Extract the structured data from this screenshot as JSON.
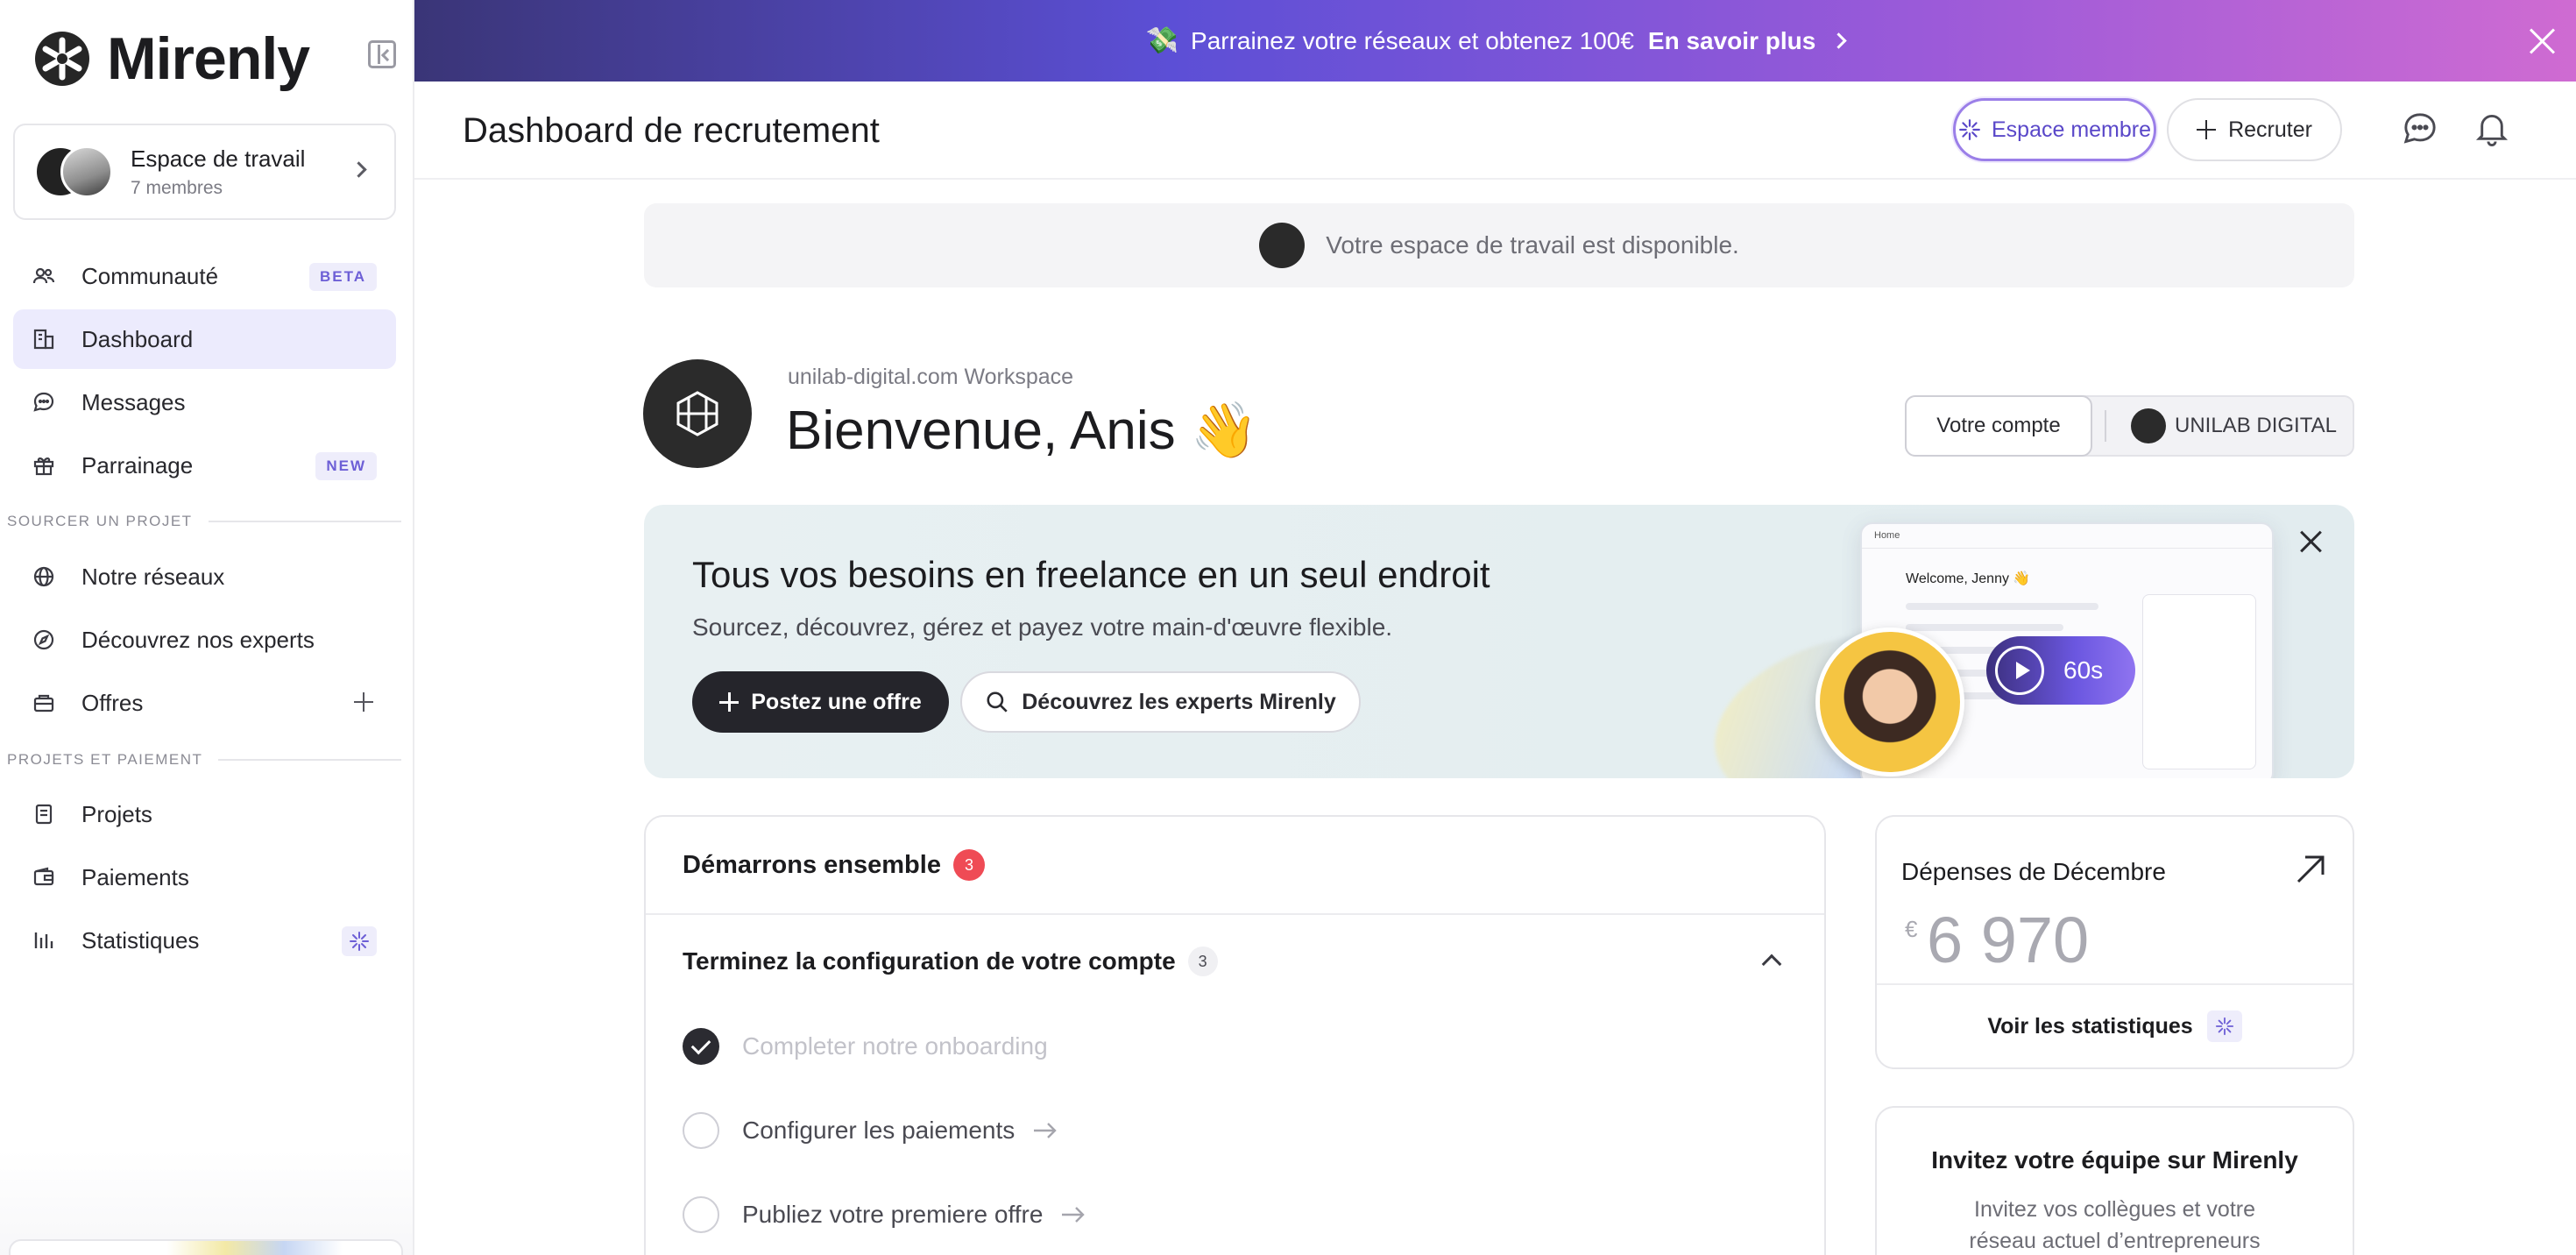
{
  "brand": {
    "name": "Mirenly"
  },
  "sidebar": {
    "workspace": {
      "title": "Espace de travail",
      "members": "7 membres"
    },
    "items": [
      {
        "label": "Communauté",
        "badge": "BETA",
        "icon": "users-icon"
      },
      {
        "label": "Dashboard",
        "icon": "building-icon",
        "active": true
      },
      {
        "label": "Messages",
        "icon": "chat-icon"
      },
      {
        "label": "Parrainage",
        "badge": "NEW",
        "icon": "gift-icon"
      },
      {
        "label": "Notre réseaux",
        "icon": "globe-icon"
      },
      {
        "label": "Découvrez nos experts",
        "icon": "compass-icon"
      },
      {
        "label": "Offres",
        "icon": "box-icon"
      },
      {
        "label": "Projets",
        "icon": "document-icon"
      },
      {
        "label": "Paiements",
        "icon": "wallet-icon"
      },
      {
        "label": "Statistiques",
        "icon": "chart-icon"
      }
    ],
    "sections": {
      "source": "SOURCER UN PROJET",
      "projects": "PROJETS ET PAIEMENT"
    }
  },
  "banner": {
    "emoji": "💸",
    "text": "Parrainez votre réseaux et obtenez 100€",
    "link": "En savoir plus"
  },
  "header": {
    "title": "Dashboard de recrutement",
    "member_button": "Espace membre",
    "recruit_button": "Recruter"
  },
  "notice": {
    "text": "Votre espace de travail est disponible."
  },
  "welcome": {
    "workspace_name": "unilab-digital.com Workspace",
    "title": "Bienvenue, Anis 👋",
    "account_button": "Votre compte",
    "company_button": "UNILAB DIGITAL"
  },
  "promo": {
    "title": "Tous vos besoins en freelance en un seul endroit",
    "subtitle": "Sourcez, découvrez, gérez et payez votre main-d'œuvre flexible.",
    "post_button": "Postez une offre",
    "discover_button": "Découvrez les experts Mirenly",
    "video_duration": "60s",
    "mock_home": "Home",
    "mock_welcome": "Welcome, Jenny 👋"
  },
  "onboarding": {
    "title": "Démarrons ensemble",
    "count": "3",
    "section_title": "Terminez la configuration de votre compte",
    "section_count": "3",
    "tasks": [
      {
        "label": "Completer notre onboarding",
        "done": true
      },
      {
        "label": "Configurer les paiements",
        "done": false
      },
      {
        "label": "Publiez votre premiere offre",
        "done": false
      }
    ]
  },
  "spending": {
    "title": "Dépenses de Décembre",
    "currency": "€",
    "amount": "6 970",
    "link": "Voir les statistiques"
  },
  "invite": {
    "title": "Invitez votre équipe sur Mirenly",
    "subtitle": "Invitez vos collègues et votre réseau actuel d’entrepreneurs"
  },
  "colors": {
    "accent": "#6d5fd6",
    "banner_start": "#3a3577",
    "banner_end": "#cf6bd2",
    "danger": "#ef4b55"
  }
}
